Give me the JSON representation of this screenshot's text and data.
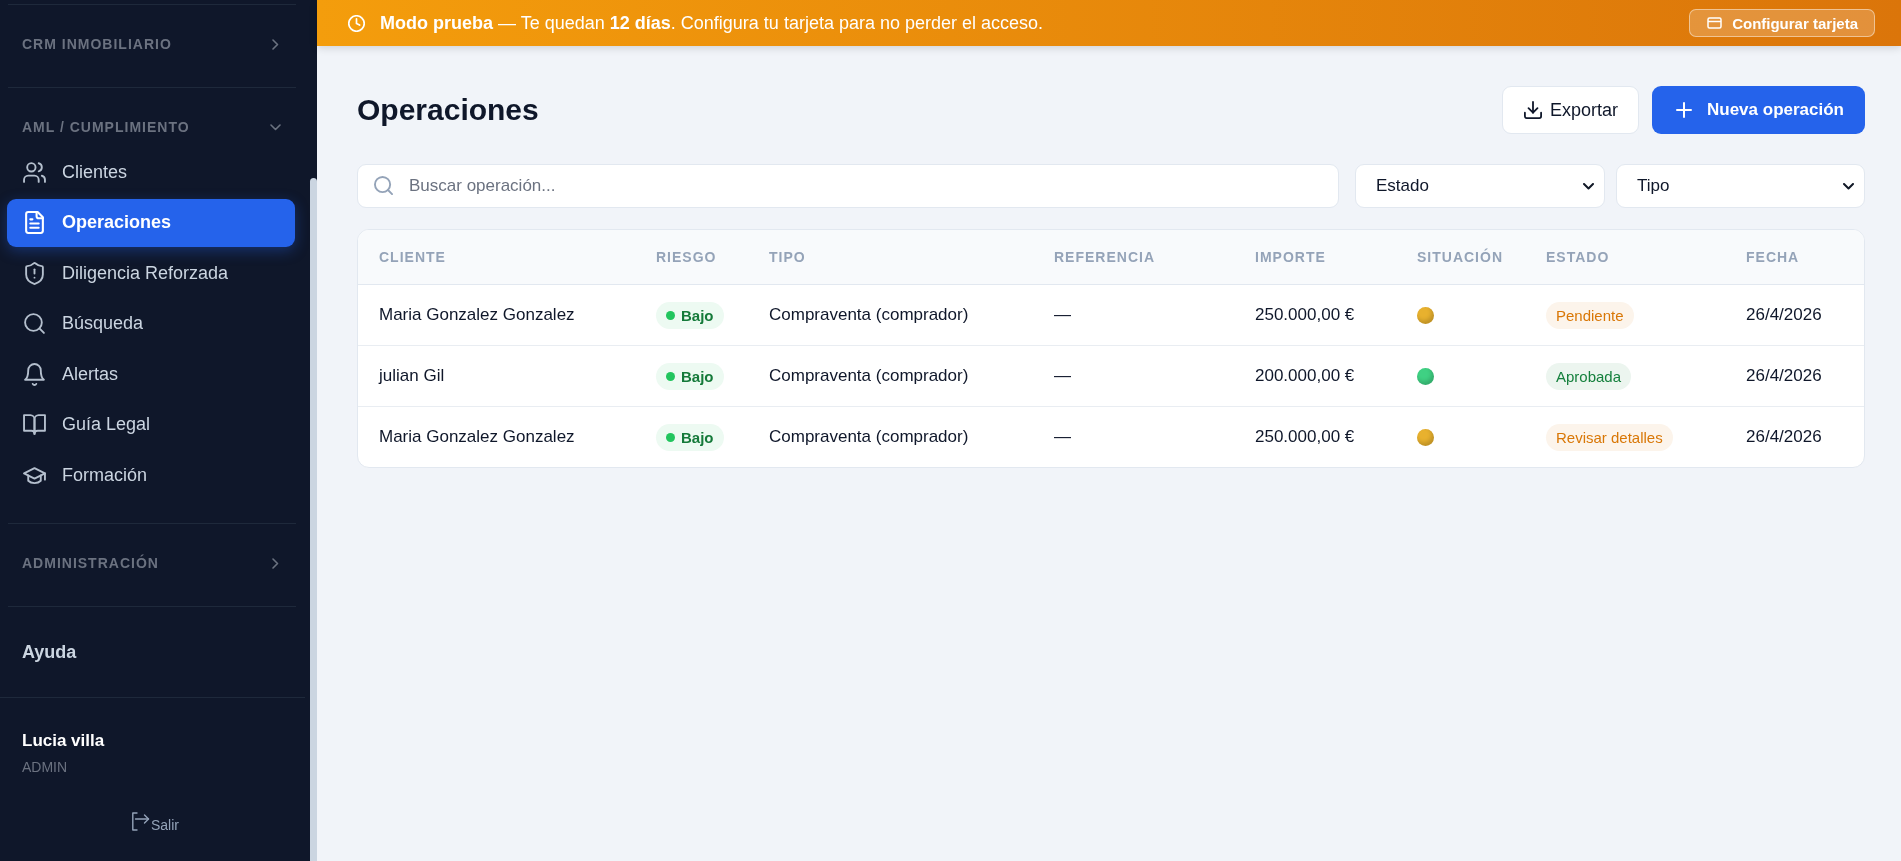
{
  "sidebar": {
    "sections": [
      {
        "title": "CRM INMOBILIARIO",
        "expanded": false
      },
      {
        "title": "AML / CUMPLIMIENTO",
        "expanded": true,
        "items": [
          {
            "label": "Clientes",
            "selected": false
          },
          {
            "label": "Operaciones",
            "selected": true
          },
          {
            "label": "Diligencia Reforzada",
            "selected": false
          },
          {
            "label": "Búsqueda",
            "selected": false
          },
          {
            "label": "Alertas",
            "selected": false
          },
          {
            "label": "Guía Legal",
            "selected": false
          },
          {
            "label": "Formación",
            "selected": false
          }
        ]
      },
      {
        "title": "ADMINISTRACIÓN",
        "expanded": false
      }
    ],
    "help": "Ayuda",
    "user": {
      "name": "Lucia villa",
      "role": "ADMIN"
    },
    "logout": "Salir"
  },
  "banner": {
    "message": "**Modo prueba** — Te quedan **12 días**. Configura tu tarjeta para no perder el acceso.",
    "button": "Configurar tarjeta"
  },
  "page": {
    "title": "Operaciones",
    "export_button": "Exportar",
    "new_button": "Nueva operación"
  },
  "filters": {
    "search": {
      "placeholder": "Buscar operación..."
    },
    "selects": [
      {
        "value": "Estado"
      },
      {
        "value": "Tipo"
      }
    ]
  },
  "table": {
    "columns": [
      "CLIENTE",
      "RIESGO",
      "TIPO",
      "REFERENCIA",
      "IMPORTE",
      "SITUACIÓN",
      "ESTADO",
      "FECHA"
    ],
    "rows": [
      {
        "cliente": "Maria Gonzalez Gonzalez",
        "riesgo": {
          "label": "Bajo",
          "color": "#22c55e"
        },
        "tipo": "Compraventa (comprador)",
        "referencia": "—",
        "importe": "250.000,00 €",
        "situacion": {
          "color": "#e8b12e"
        },
        "estado": {
          "label": "Pendiente",
          "color": "#d97706"
        },
        "fecha": "26/4/2026"
      },
      {
        "cliente": "julian Gil",
        "riesgo": {
          "label": "Bajo",
          "color": "#22c55e"
        },
        "tipo": "Compraventa (comprador)",
        "referencia": "—",
        "importe": "200.000,00 €",
        "situacion": {
          "color": "#3fd183"
        },
        "estado": {
          "label": "Aprobada",
          "color": "#15803d"
        },
        "fecha": "26/4/2026"
      },
      {
        "cliente": "Maria Gonzalez Gonzalez",
        "riesgo": {
          "label": "Bajo",
          "color": "#22c55e"
        },
        "tipo": "Compraventa (comprador)",
        "referencia": "—",
        "importe": "250.000,00 €",
        "situacion": {
          "color": "#e8b12e"
        },
        "estado": {
          "label": "Revisar detalles",
          "color": "#d97706"
        },
        "fecha": "26/4/2026"
      }
    ]
  }
}
